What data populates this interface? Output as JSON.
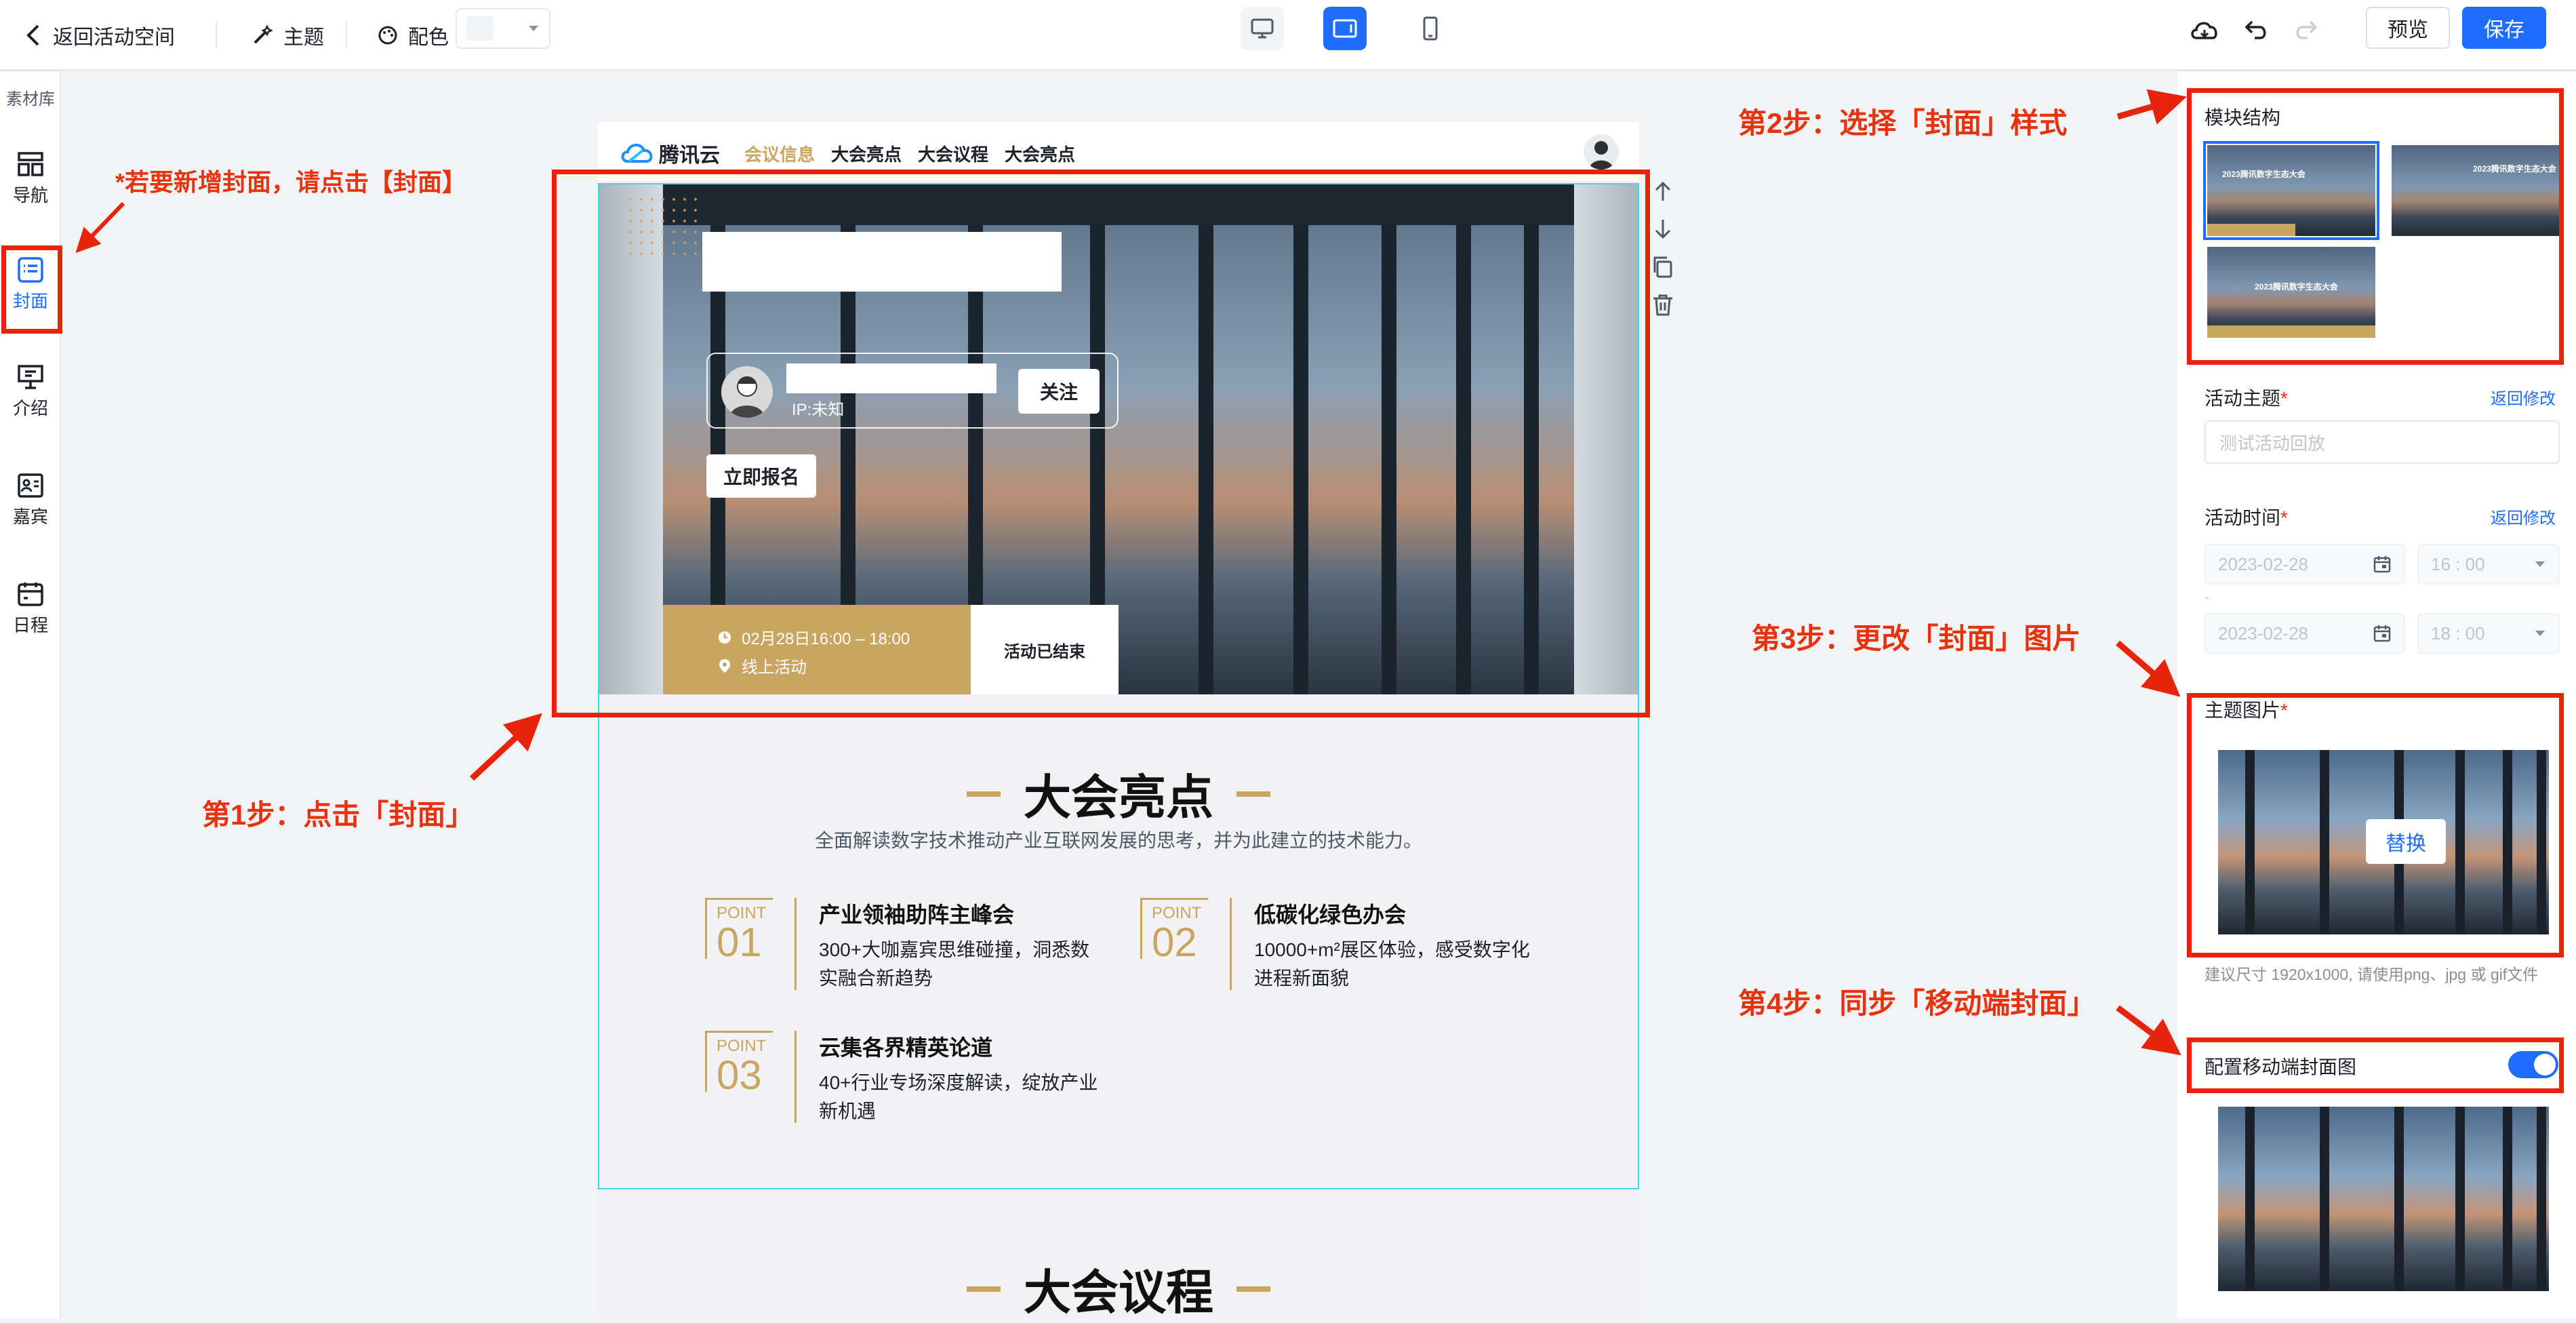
{
  "topbar": {
    "back_label": "返回活动空间",
    "theme_label": "主题",
    "color_label": "配色",
    "preview_label": "预览",
    "save_label": "保存"
  },
  "leftbar": {
    "title": "素材库",
    "items": [
      {
        "label": "导航",
        "icon": "navigation-icon"
      },
      {
        "label": "封面",
        "icon": "cover-icon"
      },
      {
        "label": "介绍",
        "icon": "intro-icon"
      },
      {
        "label": "嘉宾",
        "icon": "guest-icon"
      },
      {
        "label": "日程",
        "icon": "schedule-icon"
      }
    ],
    "active_index": 1
  },
  "annotations": {
    "new_cover": "*若要新增封面，请点击【封面】",
    "step1": "第1步：点击「封面」",
    "step2": "第2步：选择「封面」样式",
    "step3": "第3步：更改「封面」图片",
    "step4": "第4步：同步「移动端封面」"
  },
  "page": {
    "logo": "腾讯云",
    "nav": [
      "会议信息",
      "大会亮点",
      "大会议程",
      "大会亮点"
    ],
    "cover": {
      "ip": "IP:未知",
      "follow": "关注",
      "signup": "立即报名",
      "time": "02月28日16:00 – 18:00",
      "location": "线上活动",
      "status": "活动已结束"
    },
    "highlights": {
      "title": "大会亮点",
      "subtitle": "全面解读数字技术推动产业互联网发展的思考，并为此建立的技术能力。",
      "points": [
        {
          "word": "POINT",
          "num": "01",
          "title": "产业领袖助阵主峰会",
          "desc": "300+大咖嘉宾思维碰撞，洞悉数实融合新趋势"
        },
        {
          "word": "POINT",
          "num": "02",
          "title": "低碳化绿色办会",
          "desc": "10000+m²展区体验，感受数字化进程新面貌"
        },
        {
          "word": "POINT",
          "num": "03",
          "title": "云集各界精英论道",
          "desc": "40+行业专场深度解读，绽放产业新机遇"
        }
      ]
    },
    "agenda_title": "大会议程"
  },
  "panel": {
    "module_structure": "模块结构",
    "thumb_text": "2023腾讯数字生态大会",
    "event_theme_label": "活动主题",
    "event_theme_link": "返回修改",
    "event_theme_placeholder": "测试活动回放",
    "event_time_label": "活动时间",
    "event_time_link": "返回修改",
    "start_date": "2023-02-28",
    "start_time": "16 : 00",
    "end_date": "2023-02-28",
    "end_time": "18 : 00",
    "range_sep": "-",
    "theme_image_label": "主题图片",
    "replace_label": "替换",
    "size_hint": "建议尺寸 1920x1000, 请使用png、jpg 或 gif文件",
    "mobile_cover_label": "配置移动端封面图",
    "mobile_cover_enabled": true
  },
  "colors": {
    "accent": "#1f6dff",
    "annotation_red": "#e8320e",
    "gold": "#c9a65f",
    "selection_cyan": "#3cd7e0"
  }
}
